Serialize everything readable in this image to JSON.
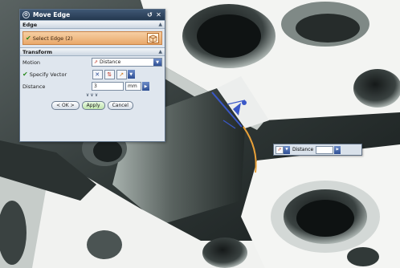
{
  "dialog": {
    "title": "Move Edge",
    "sections": {
      "edge": {
        "label": "Edge",
        "select_label": "Select Edge (2)"
      },
      "transform": {
        "label": "Transform",
        "motion_label": "Motion",
        "motion_value": "Distance",
        "vector_label": "Specify Vector",
        "distance_label": "Distance",
        "distance_value": "3",
        "distance_unit": "mm"
      }
    },
    "more": "∨∨∨",
    "buttons": {
      "ok": "< OK >",
      "apply": "Apply",
      "cancel": "Cancel"
    }
  },
  "floating_input": {
    "label": "Distance"
  },
  "icons": {
    "dialog_gear": "gear-icon",
    "reset": "reset-icon",
    "close": "close-icon",
    "edge_cube": "cube-edge-icon",
    "motion_type": "distance-motion-icon",
    "vector_x": "vector-x-icon",
    "vector_reverse": "reverse-direction-icon",
    "vector_inferred": "inferred-vector-icon"
  },
  "colors": {
    "title_bar": "#2e4560",
    "selection_highlight": "#eab07a",
    "selected_edge": "#e8a038",
    "vector_arrow": "#3a58c8"
  }
}
